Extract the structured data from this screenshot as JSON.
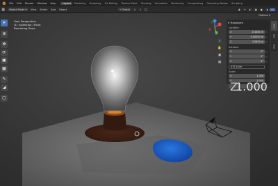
{
  "top_menu": [
    "File",
    "Edit",
    "Render",
    "Window",
    "Help"
  ],
  "workspace_tabs": [
    "Layout",
    "Modeling",
    "Sculpting",
    "UV Editing",
    "Texture Paint",
    "Shading",
    "Animation",
    "Rendering",
    "Compositing",
    "Geometry Nodes",
    "Scripting"
  ],
  "active_workspace": "Layout",
  "header": {
    "mode": "Object Mode",
    "menus": [
      "View",
      "Select",
      "Add",
      "Object"
    ],
    "orientation": "Global",
    "options": "Options"
  },
  "viewport": {
    "perspective": "User Perspective",
    "collection": "(1) Collection | Point",
    "status": "Rendering Done"
  },
  "sidebar_tabs": [
    "Item",
    "Tool",
    "View"
  ],
  "npanel": {
    "title": "Transform",
    "location_label": "Location:",
    "location": [
      {
        "axis": "X",
        "value": "-0.4464 m"
      },
      {
        "axis": "Y",
        "value": "0.00000 m"
      },
      {
        "axis": "Z",
        "value": "3.0655 m"
      }
    ],
    "rotation_label": "Rotation:",
    "rotation": [
      {
        "axis": "X",
        "value": "0°"
      },
      {
        "axis": "Y",
        "value": "0°"
      },
      {
        "axis": "Z",
        "value": "0°"
      }
    ],
    "rotation_mode": "XYZ Euler",
    "scale_label": "Scale:",
    "scale": [
      {
        "axis": "X",
        "value": "1.000"
      },
      {
        "axis": "Y",
        "value": "1.000"
      },
      {
        "axis": "Z",
        "value": "1.000"
      }
    ]
  },
  "colors": {
    "accent": "#4772b3",
    "viewport_bg": "#3a3a3a",
    "header_bg": "#232323",
    "object_blue": "#1f5fc6"
  }
}
